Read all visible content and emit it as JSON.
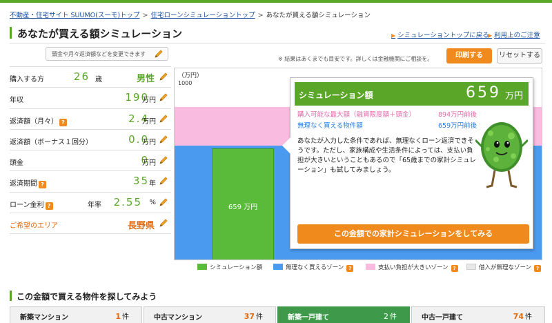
{
  "breadcrumb": {
    "items": [
      "不動産・住宅サイト SUUMO(スーモ)トップ",
      "住宅ローンシミュレーショントップ"
    ],
    "current": "あなたが買える額シミュレーション",
    "separator": ">"
  },
  "page_title": "あなたが買える額シミュレーション",
  "top_links": {
    "back_to_top": "シミュレーショントップに戻る",
    "usage_guide": "利用上のご注意"
  },
  "tooltip": "頭金や月々返済額などを変更できます",
  "notice": "※ 結果はあくまでも目安です。詳しくは金融機関にご相談を。",
  "buttons": {
    "print": "印刷する",
    "reset": "リセットする"
  },
  "params": {
    "age": {
      "label": "購入する方",
      "value": "26",
      "unit": "歳",
      "gender": "男性"
    },
    "income": {
      "label": "年収",
      "value": "190",
      "unit": "万円"
    },
    "monthly": {
      "label": "返済額（月々）",
      "value": "2.4",
      "unit": "万円"
    },
    "bonus": {
      "label": "返済額（ボーナス１回分）",
      "value": "0.0",
      "unit": "万円"
    },
    "down": {
      "label": "頭金",
      "value": "0",
      "unit": "万円"
    },
    "period": {
      "label": "返済期間",
      "value": "35",
      "unit": "年"
    },
    "rate": {
      "label": "ローン金利",
      "prefix": "年率",
      "value": "2.55",
      "unit": "%"
    },
    "area": {
      "label": "ご希望のエリア",
      "value": "長野県"
    }
  },
  "chart": {
    "unit_label": "（万円）",
    "tick_top": "1000",
    "bar_label": "659 万円"
  },
  "result": {
    "header_label": "シミュレーション額",
    "amount": "659",
    "amount_unit": "万円",
    "max_label": "購入可能な最大額（融資限度額＋頭金）",
    "max_value": "894万円前後",
    "safe_label": "無理なく買える物件額",
    "safe_value": "659万円前後",
    "message": "あなたが入力した条件であれば、無理なくローン返済できそうです。ただし、家族構成や生活条件によっては、支払い負担が大きいということもあるので「65歳までの家計シミュレーション」も試してみましょう。",
    "cta": "この金額での家計シミュレーションをしてみる"
  },
  "legend": [
    "シミュレーション額",
    "無理なく買えるゾーン",
    "支払い負担が大きいゾーン",
    "借入が無理なゾーン"
  ],
  "colors": {
    "green": "#5aba3a",
    "blue": "#4a9bf0",
    "pink": "#f9bce0",
    "gray": "#e8e8e8",
    "orange": "#f08a1c",
    "brand": "#5aa628"
  },
  "section_title": "この金額で買える物件を探してみよう",
  "tabs": [
    {
      "name": "新築マンション",
      "count": "1",
      "unit": "件"
    },
    {
      "name": "中古マンション",
      "count": "37",
      "unit": "件"
    },
    {
      "name": "新築一戸建て",
      "count": "2",
      "unit": "件"
    },
    {
      "name": "中古一戸建て",
      "count": "74",
      "unit": "件"
    }
  ],
  "icons": {
    "edit": "pencil-icon",
    "help": "question-icon",
    "link_arrow": "triangle-right-icon"
  }
}
